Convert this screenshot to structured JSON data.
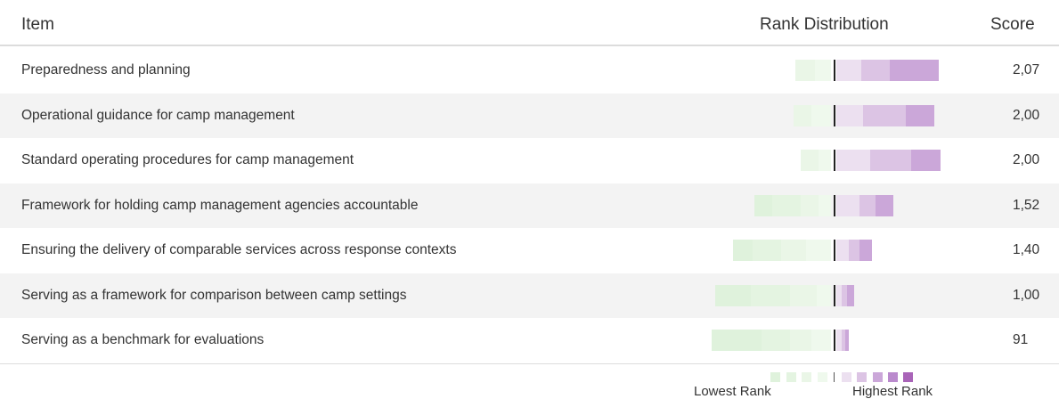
{
  "header": {
    "item": "Item",
    "distribution": "Rank Distribution",
    "score": "Score"
  },
  "legend": {
    "lowest": "Lowest Rank",
    "highest": "Highest Rank",
    "colors_low": [
      "#dff2dc",
      "#e4f4e1",
      "#eaf6e7",
      "#eff9ed"
    ],
    "colors_high": [
      "#ece0f0",
      "#dcc4e4",
      "#cba7d9",
      "#ba8acd",
      "#a964b8"
    ]
  },
  "chart_data": {
    "type": "table",
    "columns": [
      "Item",
      "Rank Distribution",
      "Score"
    ],
    "rows": [
      {
        "label": "Preparedness and planning",
        "score": "2,07",
        "low": [
          0,
          0,
          22,
          18
        ],
        "high": [
          28,
          32,
          55,
          0,
          0
        ]
      },
      {
        "label": "Operational guidance for camp management",
        "score": "2,00",
        "low": [
          0,
          0,
          20,
          22
        ],
        "high": [
          30,
          48,
          32,
          0,
          0
        ]
      },
      {
        "label": "Standard operating procedures for camp management",
        "score": "2,00",
        "low": [
          0,
          0,
          20,
          14
        ],
        "high": [
          38,
          46,
          33,
          0,
          0
        ]
      },
      {
        "label": "Framework for holding camp management agencies accountable",
        "score": "1,52",
        "low": [
          20,
          32,
          20,
          14
        ],
        "high": [
          26,
          18,
          20,
          0,
          0
        ]
      },
      {
        "label": "Ensuring the delivery of comparable services across response contexts",
        "score": "1,40",
        "low": [
          22,
          32,
          28,
          28
        ],
        "high": [
          14,
          12,
          14,
          0,
          0
        ]
      },
      {
        "label": "Serving as a framework for comparison between camp settings",
        "score": "1,00",
        "low": [
          40,
          44,
          30,
          16
        ],
        "high": [
          6,
          6,
          8,
          0,
          0
        ]
      },
      {
        "label": "Serving as a benchmark for evaluations",
        "score": "91",
        "low": [
          56,
          32,
          24,
          22
        ],
        "high": [
          6,
          4,
          4,
          0,
          0
        ]
      }
    ]
  }
}
